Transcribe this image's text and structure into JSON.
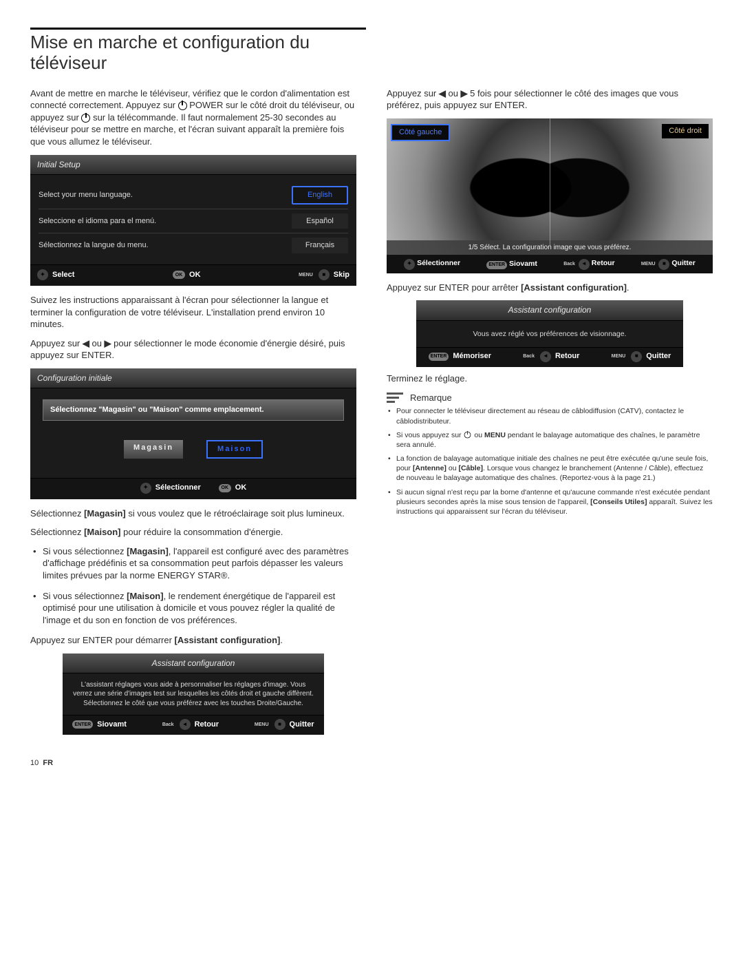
{
  "title": "Mise en marche et configuration du téléviseur",
  "left": {
    "intro_1": "Avant de mettre en marche le téléviseur, vérifiez que le cordon d'alimentation est connecté correctement. Appuyez sur ",
    "power_word": " POWER",
    "intro_2": " sur le côté droit du téléviseur, ou appuyez sur ",
    "intro_3": " sur la télécommande. Il faut normalement 25-30 secondes au téléviseur pour se mettre en marche, et l'écran suivant apparaît la première fois que vous allumez le téléviseur.",
    "osd1": {
      "title": "Initial Setup",
      "row1": "Select your menu language.",
      "opt1": "English",
      "row2": "Seleccione el idioma para el menú.",
      "opt2": "Español",
      "row3": "Sélectionnez la langue du menu.",
      "opt3": "Français",
      "foot_select": "Select",
      "foot_ok": "OK",
      "foot_skip": "Skip",
      "menu_sup": "MENU",
      "ok_pill": "OK"
    },
    "para2": "Suivez les instructions apparaissant à l'écran pour sélectionner la langue et terminer la configuration de votre téléviseur. L'installation prend environ 10 minutes.",
    "para3_a": "Appuyez sur ",
    "para3_b": " ou ",
    "para3_c": " pour sélectionner le mode économie d'énergie désiré, puis appuyez sur ENTER.",
    "osd2": {
      "title": "Configuration initiale",
      "banner": "Sélectionnez \"Magasin\" ou \"Maison\" comme emplacement.",
      "chip_store": "Magasin",
      "chip_home": "Maison",
      "foot_sel": "Sélectionner",
      "foot_ok": "OK",
      "ok_pill": "OK"
    },
    "sel_magasin_a": "Sélectionnez ",
    "sel_magasin_b": "[Magasin]",
    "sel_magasin_c": " si vous voulez que le rétroéclairage soit plus lumineux.",
    "sel_maison_a": "Sélectionnez ",
    "sel_maison_b": "[Maison]",
    "sel_maison_c": " pour réduire la consommation d'énergie.",
    "bullet1_a": "Si vous sélectionnez ",
    "bullet1_b": "[Magasin]",
    "bullet1_c": ", l'appareil est configuré avec des paramètres d'affichage prédéfinis et sa consommation peut parfois dépasser les valeurs limites prévues par la norme ENERGY STAR®.",
    "bullet2_a": "Si vous sélectionnez ",
    "bullet2_b": "[Maison]",
    "bullet2_c": ", le rendement énergétique de l'appareil est optimisé pour une utilisation à domicile et vous pouvez régler la qualité de l'image et du son en fonction de vos préférences.",
    "para4_a": "Appuyez sur ENTER pour démarrer ",
    "para4_b": "[Assistant configuration]",
    "para4_c": ".",
    "osd3": {
      "title": "Assistant configuration",
      "body": "L'assistant réglages vous aide à personnaliser les réglages d'image. Vous verrez une série d'images test sur lesquelles les côtés droit et gauche diffèrent. Sélectionnez le côté que vous préférez avec les touches Droite/Gauche.",
      "foot_next": "Siovamt",
      "foot_back": "Retour",
      "foot_quit": "Quitter",
      "enter_pill": "ENTER",
      "back_sup": "Back",
      "menu_sup": "MENU"
    }
  },
  "right": {
    "top_a": "Appuyez sur ",
    "top_b": " ou ",
    "top_c": " 5 fois pour sélectionner le côté des images que vous préférez, puis appuyez sur ENTER.",
    "pic": {
      "left_tag": "Côté gauche",
      "right_tag": "Côté droit",
      "bar": "1/5 Sélect. La configuration image que vous préférez.",
      "foot_sel": "Sélectionner",
      "foot_next": "Siovamt",
      "foot_back": "Retour",
      "foot_quit": "Quitter",
      "enter_pill": "ENTER",
      "back_sup": "Back",
      "menu_sup": "MENU"
    },
    "para2_a": "Appuyez sur ENTER pour arrêter ",
    "para2_b": "[Assistant configuration]",
    "para2_c": ".",
    "osd4": {
      "title": "Assistant configuration",
      "body": "Vous avez réglé vos préférences de visionnage.",
      "foot_store": "Mémoriser",
      "foot_back": "Retour",
      "foot_quit": "Quitter",
      "enter_pill": "ENTER",
      "back_sup": "Back",
      "menu_sup": "MENU"
    },
    "finish": "Terminez le réglage.",
    "note_label": "Remarque",
    "notes": {
      "n1": "Pour connecter le téléviseur directement au réseau de câblodiffusion (CATV), contactez le câblodistributeur.",
      "n2_a": "Si vous appuyez sur ",
      "n2_b": " ou ",
      "n2_c": "MENU",
      "n2_d": " pendant le balayage automatique des chaînes, le paramètre sera annulé.",
      "n3_a": "La fonction de balayage automatique initiale des chaînes ne peut être exécutée qu'une seule fois, pour ",
      "n3_b": "[Antenne]",
      "n3_c": " ou ",
      "n3_d": "[Câble]",
      "n3_e": ". Lorsque vous changez le branchement (Antenne / Câble), effectuez de nouveau le balayage automatique des chaînes. (Reportez-vous à la page 21.)",
      "n4_a": "Si aucun signal n'est reçu par la borne d'antenne et qu'aucune commande n'est exécutée pendant plusieurs secondes après la mise sous tension de l'appareil, ",
      "n4_b": "[Conseils Utiles]",
      "n4_c": " apparaît. Suivez les instructions qui apparaissent sur l'écran du téléviseur."
    }
  },
  "page_num": "10",
  "page_lang": "FR"
}
